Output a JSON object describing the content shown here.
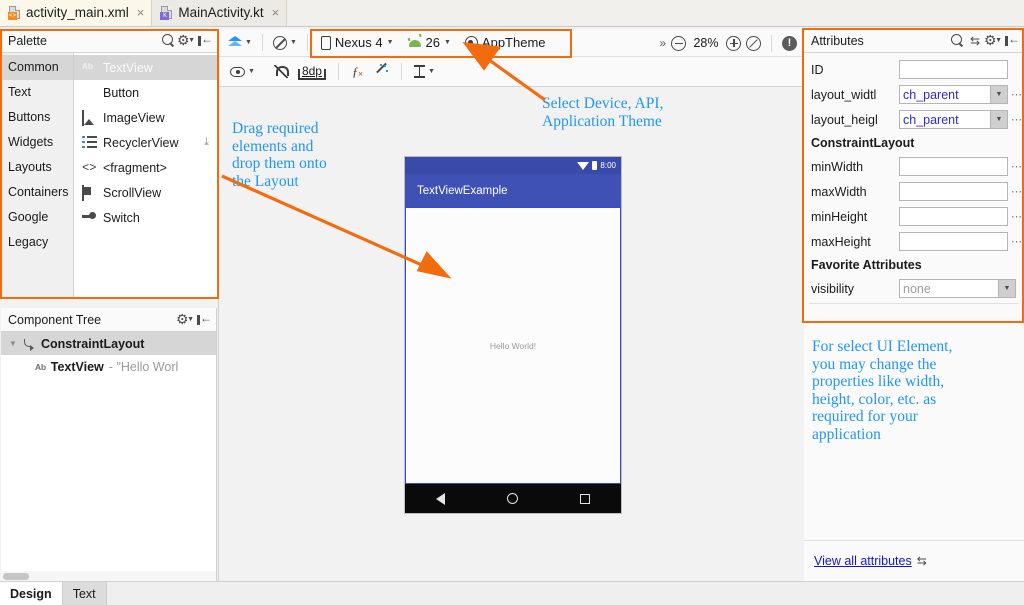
{
  "editor_tabs": [
    {
      "label": "activity_main.xml",
      "icon": "xml-file-icon",
      "active": true,
      "close": "×"
    },
    {
      "label": "MainActivity.kt",
      "icon": "kotlin-file-icon",
      "active": false,
      "close": "×"
    }
  ],
  "palette": {
    "title": "Palette",
    "search_icon": "search-icon",
    "gear_icon": "gear-icon",
    "hide_icon": "hide-panel-icon",
    "categories": [
      {
        "label": "Common",
        "selected": true
      },
      {
        "label": "Text",
        "selected": false
      },
      {
        "label": "Buttons",
        "selected": false
      },
      {
        "label": "Widgets",
        "selected": false
      },
      {
        "label": "Layouts",
        "selected": false
      },
      {
        "label": "Containers",
        "selected": false
      },
      {
        "label": "Google",
        "selected": false
      },
      {
        "label": "Legacy",
        "selected": false
      }
    ],
    "items": [
      {
        "label": "TextView",
        "icon": "textview-icon",
        "selected": true,
        "download": ""
      },
      {
        "label": "Button",
        "icon": "button-icon",
        "selected": false,
        "download": ""
      },
      {
        "label": "ImageView",
        "icon": "imageview-icon",
        "selected": false,
        "download": ""
      },
      {
        "label": "RecyclerView",
        "icon": "recyclerview-icon",
        "selected": false,
        "download": "⤓"
      },
      {
        "label": "<fragment>",
        "icon": "fragment-icon",
        "selected": false,
        "download": ""
      },
      {
        "label": "ScrollView",
        "icon": "scrollview-icon",
        "selected": false,
        "download": ""
      },
      {
        "label": "Switch",
        "icon": "switch-icon",
        "selected": false,
        "download": ""
      }
    ]
  },
  "component_tree": {
    "title": "Component Tree",
    "gear_icon": "gear-icon",
    "hide_icon": "hide-panel-icon",
    "rows": [
      {
        "name": "ConstraintLayout",
        "sub": "",
        "icon": "constraintlayout-icon",
        "depth": 0,
        "selected": true,
        "expanded": true
      },
      {
        "name": "TextView",
        "sub": " - \"Hello Worl",
        "icon": "textview-icon",
        "depth": 1,
        "selected": false
      }
    ]
  },
  "toolbar": {
    "design_mode_icon": "layers-icon",
    "blueprint_icon": "blueprint-icon",
    "device": "Nexus 4",
    "api": "26",
    "theme": "AppTheme",
    "overflow": "»",
    "zoom_out_icon": "zoom-out-icon",
    "zoom_level": "28%",
    "zoom_in_icon": "zoom-in-icon",
    "zoom_fit_icon": "zoom-fit-icon",
    "warning_icon": "warning-icon",
    "warning_glyph": "!"
  },
  "toolbar2": {
    "visibility_icon": "eye-icon",
    "autoconnect_icon": "magnet-off-icon",
    "margin_value": "8dp",
    "clear_constraints_icon": "clear-constraints-icon",
    "infer_constraints_icon": "magic-wand-icon",
    "baseline_icon": "baseline-icon"
  },
  "device_preview": {
    "status_time": "8:00",
    "wifi_icon": "wifi-icon",
    "battery_icon": "battery-icon",
    "app_bar_title": "TextViewExample",
    "content_text": "Hello World!",
    "nav_back_icon": "nav-back-icon",
    "nav_home_icon": "nav-home-icon",
    "nav_recents_icon": "nav-recents-icon"
  },
  "attributes": {
    "title": "Attributes",
    "search_icon": "search-icon",
    "swap_icon": "swap-icon",
    "gear_icon": "gear-icon",
    "hide_icon": "hide-panel-icon",
    "rows": [
      {
        "label": "ID",
        "value": "",
        "placeholder": "",
        "type": "text",
        "dots": "⋯",
        "show_dots": false
      },
      {
        "label": "layout_widtl",
        "value": "ch_parent",
        "type": "dropdown",
        "dots": "⋯",
        "show_dots": true
      },
      {
        "label": "layout_heigl",
        "value": "ch_parent",
        "type": "dropdown",
        "dots": "⋯",
        "show_dots": true
      }
    ],
    "group1": "ConstraintLayout",
    "group1_rows": [
      {
        "label": "minWidth",
        "value": "",
        "type": "text",
        "dots": "⋯",
        "show_dots": true
      },
      {
        "label": "maxWidth",
        "value": "",
        "type": "text",
        "dots": "⋯",
        "show_dots": true
      },
      {
        "label": "minHeight",
        "value": "",
        "type": "text",
        "dots": "⋯",
        "show_dots": true
      },
      {
        "label": "maxHeight",
        "value": "",
        "type": "text",
        "dots": "⋯",
        "show_dots": true
      }
    ],
    "group2": "Favorite Attributes",
    "group2_rows": [
      {
        "label": "visibility",
        "value": "none",
        "type": "dropdown",
        "muted": true,
        "dots": "",
        "show_dots": false
      }
    ],
    "view_all_link": "View all attributes",
    "view_all_icon": "swap-icon"
  },
  "annotations": [
    {
      "name": "drag-elements-note",
      "text": "Drag  required\nelements  and\ndrop  them  onto\nthe  Layout"
    },
    {
      "name": "select-device-note",
      "text": "Select  Device,  API,\nApplication  Theme"
    },
    {
      "name": "change-properties-note",
      "text": "For  select  UI  Element,\nyou  may  change  the\nproperties  like  width,\nheight,  color,  etc.  as\nrequired  for  your\napplication"
    }
  ],
  "bottom_tabs": [
    {
      "label": "Design",
      "active": true
    },
    {
      "label": "Text",
      "active": false
    }
  ],
  "colors": {
    "accent_orange": "#f26c0d",
    "annotation_blue": "#2196f3",
    "appbar_indigo": "#3f51b5",
    "selection_blue": "#3b47d6",
    "link_blue": "#1414d6",
    "attr_value_blue": "#2a2ad0"
  }
}
